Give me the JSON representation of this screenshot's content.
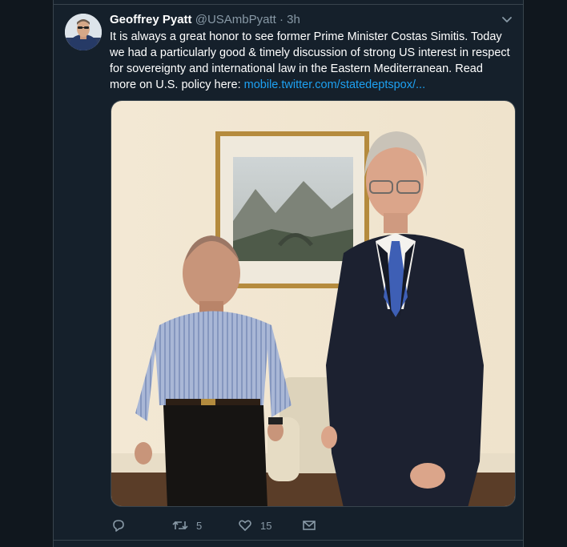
{
  "tweet": {
    "author_name": "Geoffrey Pyatt",
    "author_handle": "@USAmbPyatt",
    "separator": "·",
    "time": "3h",
    "text": "It is always a great honor to see former Prime Minister Costas Simitis. Today we had a particularly good & timely discussion of strong US interest in respect for sovereignty and international law in the Eastern Mediterranean. Read more on U.S. policy here: ",
    "link_text": "mobile.twitter.com/statedeptspox/...",
    "media": {
      "icon": "photo",
      "description_icon": "photo-icon"
    },
    "actions": {
      "reply_icon": "reply-icon",
      "retweet_icon": "retweet-icon",
      "retweet_count": "5",
      "like_icon": "heart-icon",
      "like_count": "15",
      "dm_icon": "envelope-icon"
    }
  },
  "colors": {
    "background": "#15202b",
    "outer": "#10171e",
    "text": "#ffffff",
    "secondary": "#8899a6",
    "link": "#1da1f2",
    "border": "#38444d"
  }
}
